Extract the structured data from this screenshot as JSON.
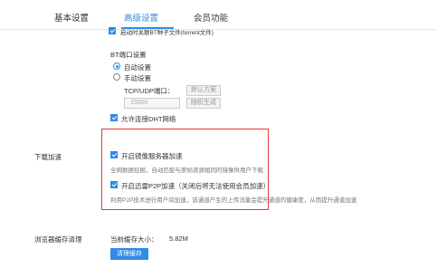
{
  "tabs": [
    {
      "label": "基本设置"
    },
    {
      "label": "高级设置"
    },
    {
      "label": "会员功能"
    }
  ],
  "bt": {
    "top_cut_text": "启动时关联BT种子文件(torrent文件)",
    "port_title": "BT端口设置",
    "auto_label": "自动设置",
    "manual_label": "手动设置",
    "port_label": "TCP/UDP端口：",
    "port_value": "15000",
    "default_btn": "默认方案",
    "random_btn": "随机生成",
    "dht_label": "允许连接DHT网络"
  },
  "download": {
    "section_label": "下载加速",
    "mirror_label": "开启镜像服务器加速",
    "mirror_desc": "全网数据挖掘，自动匹配与原始资源相同的镜像供用户下载",
    "p2p_label": "开启迅雷P2P加速（关闭后将无法使用会员加速）",
    "p2p_desc": "利用P2P技术进行用户间加速，该通道产生的上传流量会提升通道的健康度，从而提升通道加速"
  },
  "cache": {
    "section_label": "浏览器缓存清理",
    "size_label": "当前缓存大小：",
    "size_value": "5.82M",
    "clear_btn": "清理缓存"
  },
  "colors": {
    "accent": "#2f8be6",
    "highlight_box": "#e03a3a"
  }
}
